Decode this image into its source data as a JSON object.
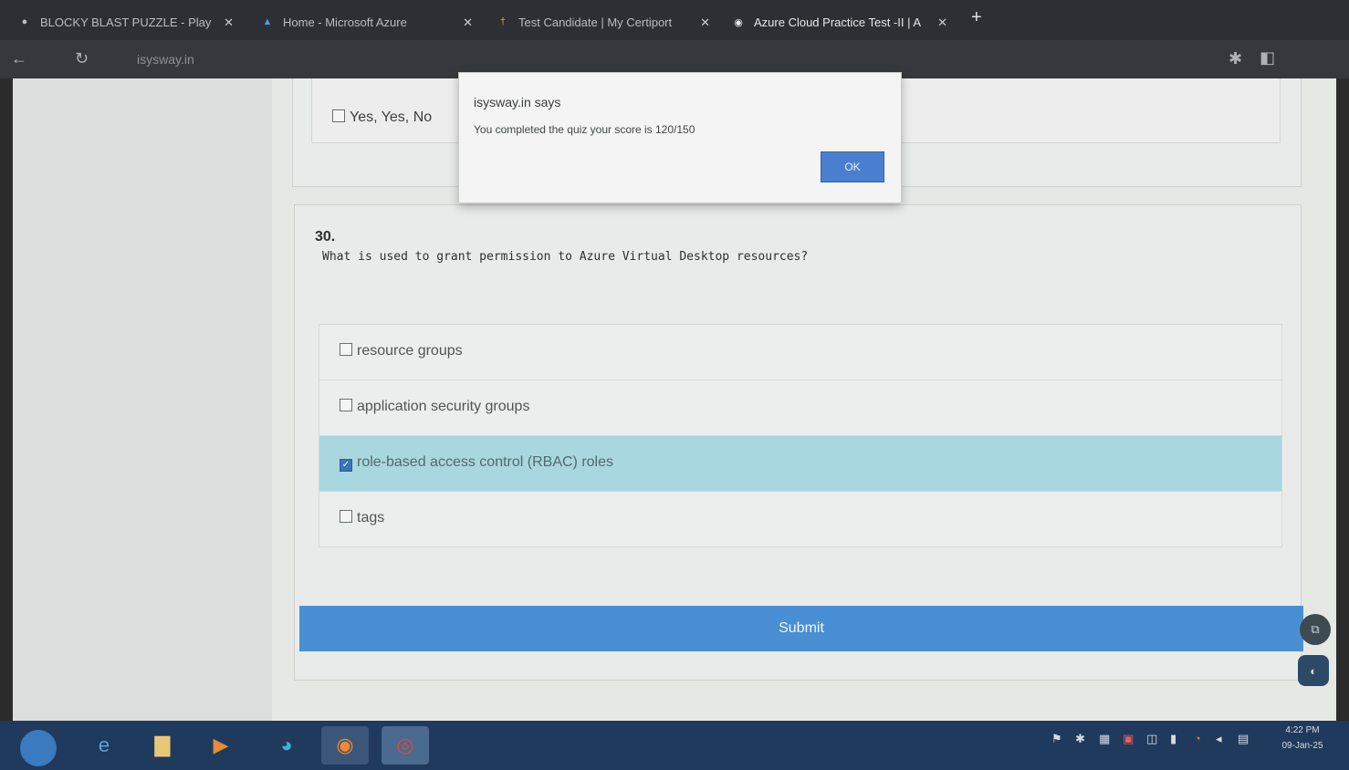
{
  "browser": {
    "tabs": [
      {
        "title": "BLOCKY BLAST PUZZLE - Play",
        "icon": "game-icon",
        "active": false
      },
      {
        "title": "Home - Microsoft Azure",
        "icon": "azure-icon",
        "active": false
      },
      {
        "title": "Test Candidate | My Certiport",
        "icon": "certiport-icon",
        "active": false
      },
      {
        "title": "Azure Cloud Practice Test -II | A",
        "icon": "globe-icon",
        "active": true
      }
    ],
    "url": "isysway.in"
  },
  "previous_question": {
    "option_label": "Yes, Yes, No"
  },
  "dialog": {
    "title": "isysway.in says",
    "message": "You completed the quiz your score is 120/150",
    "ok_label": "OK"
  },
  "question": {
    "number": "30.",
    "text": "What is used to grant permission to Azure Virtual Desktop resources?",
    "options": [
      {
        "label": "resource groups",
        "checked": false
      },
      {
        "label": "application security groups",
        "checked": false
      },
      {
        "label": "role-based access control (RBAC) roles",
        "checked": true
      },
      {
        "label": "tags",
        "checked": false
      }
    ]
  },
  "submit_label": "Submit",
  "taskbar": {
    "time": "4:22 PM",
    "date": "09-Jan-25"
  },
  "colors": {
    "selected_option": "#a9d7df",
    "submit_button": "#4a8fd4",
    "ok_button": "#4a7fd0"
  }
}
